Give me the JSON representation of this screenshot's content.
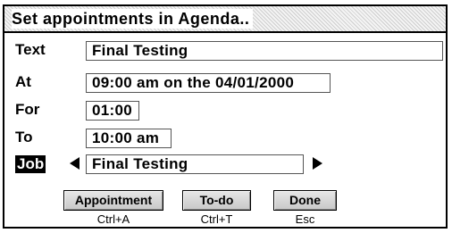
{
  "dialog": {
    "title": "Set appointments in Agenda.."
  },
  "fields": {
    "text": {
      "label": "Text",
      "value": "Final Testing"
    },
    "at": {
      "label": "At",
      "value": "09:00 am on the 04/01/2000"
    },
    "for": {
      "label": "For",
      "value": "01:00"
    },
    "to": {
      "label": "To",
      "value": "10:00 am"
    },
    "job": {
      "label": "Job",
      "value": "Final Testing"
    }
  },
  "icons": {
    "job_prev": "left-triangle-arrow-icon",
    "job_next": "right-triangle-arrow-icon"
  },
  "buttons": {
    "appointment": {
      "label": "Appointment",
      "shortcut": "Ctrl+A"
    },
    "todo": {
      "label": "To-do",
      "shortcut": "Ctrl+T"
    },
    "done": {
      "label": "Done",
      "shortcut": "Esc"
    }
  }
}
